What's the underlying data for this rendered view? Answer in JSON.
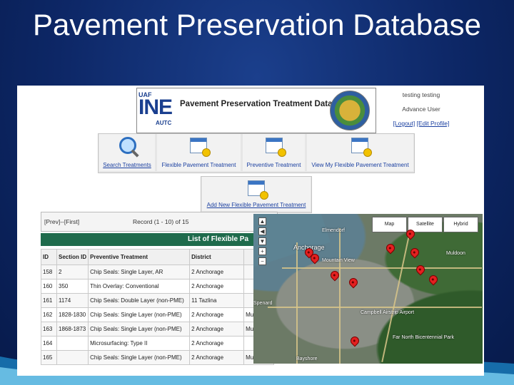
{
  "slide": {
    "title": "Pavement Preservation Database"
  },
  "banner": {
    "logo_top": "UAF",
    "logo_main": "INE",
    "logo_bottom": "AUTC",
    "title": "Pavement Preservation Treatment Database"
  },
  "user": {
    "name": "testing testing",
    "role": "Advance User",
    "logout": "[Logout]",
    "edit_profile": "[Edit Profile]"
  },
  "toolbar": {
    "search": "Search Treatments",
    "flexible": "Flexible Pavement Treatment",
    "preventive": "Preventive Treatment",
    "view_my": "View My Flexible Pavement Treatment",
    "add_new": "Add New Flexible Pavement Treatment"
  },
  "records": {
    "pager_nav": "[Prev]--[First]",
    "range": "Record (1 - 10) of 15",
    "list_title": "List of Flexible Pa",
    "columns": [
      "ID",
      "Section ID",
      "Preventive Treatment",
      "District",
      ""
    ],
    "rows": [
      [
        "158",
        "2",
        "Chip Seals: Single Layer, AR",
        "2 Anchorage",
        ""
      ],
      [
        "160",
        "350",
        "Thin Overlay: Conventional",
        "2 Anchorage",
        ""
      ],
      [
        "161",
        "1174",
        "Chip Seals: Double Layer (non-PME)",
        "11 Tazlina",
        ""
      ],
      [
        "162",
        "1828-1830",
        "Chip Seals: Single Layer (non-PME)",
        "2 Anchorage",
        "Municip"
      ],
      [
        "163",
        "1868-1873",
        "Chip Seals: Single Layer (non-PME)",
        "2 Anchorage",
        "Municip"
      ],
      [
        "164",
        "",
        "Microsurfacing: Type II",
        "2 Anchorage",
        ""
      ],
      [
        "165",
        "",
        "Chip Seals: Single Layer (non-PME)",
        "2 Anchorage",
        "Municip"
      ]
    ]
  },
  "map": {
    "types": [
      "Map",
      "Satellite",
      "Hybrid"
    ],
    "labels": {
      "city": "Anchorage",
      "airport": "Campbell Airstrip Airport",
      "park": "Far North Bicentennial Park",
      "road_a": "Mountain View",
      "road_b": "Muldoon",
      "road_c": "Elmendorf",
      "road_d": "Spenard",
      "road_e": "Bayshore"
    }
  }
}
